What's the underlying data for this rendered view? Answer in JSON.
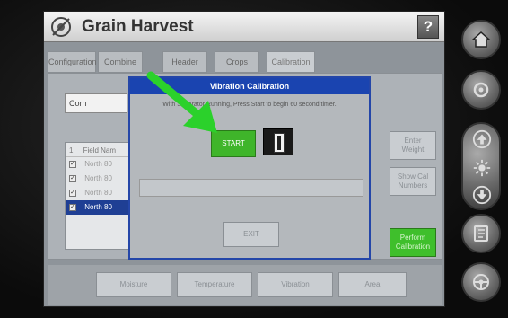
{
  "app": {
    "title": "Grain Harvest",
    "help_label": "?"
  },
  "tabs": [
    {
      "label": "Configuration"
    },
    {
      "label": "Combine"
    },
    {
      "label": "Header"
    },
    {
      "label": "Crops"
    },
    {
      "label": "Calibration"
    }
  ],
  "crop": {
    "value": "Corn"
  },
  "field_list": {
    "header_index": "1",
    "header_label": "Field Nam",
    "rows": [
      {
        "label": "North 80",
        "checked": true,
        "selected": false
      },
      {
        "label": "North 80",
        "checked": true,
        "selected": false
      },
      {
        "label": "North 80",
        "checked": true,
        "selected": false
      },
      {
        "label": "North 80",
        "checked": true,
        "selected": true
      }
    ]
  },
  "side_buttons": {
    "enter_weight": "Enter Weight",
    "show_cal_numbers": "Show Cal Numbers",
    "perform_calibration": "Perform Calibration"
  },
  "bottom_buttons": [
    {
      "label": "Moisture"
    },
    {
      "label": "Temperature"
    },
    {
      "label": "Vibration"
    },
    {
      "label": "Area"
    }
  ],
  "modal": {
    "title": "Vibration Calibration",
    "message": "With Separator Running, Press Start to begin 60 second timer.",
    "start_label": "START",
    "exit_label": "EXIT",
    "progress": 0
  },
  "hardware_buttons": [
    {
      "icon": "home-icon"
    },
    {
      "icon": "wrench-icon"
    },
    {
      "icon": "up-arrow-icon"
    },
    {
      "icon": "brightness-icon"
    },
    {
      "icon": "down-arrow-icon"
    },
    {
      "icon": "book-icon"
    },
    {
      "icon": "steering-wheel-icon"
    }
  ],
  "colors": {
    "accent_blue": "#1a44b0",
    "start_green": "#3fb52a",
    "annotation_arrow": "#2bd12b"
  }
}
